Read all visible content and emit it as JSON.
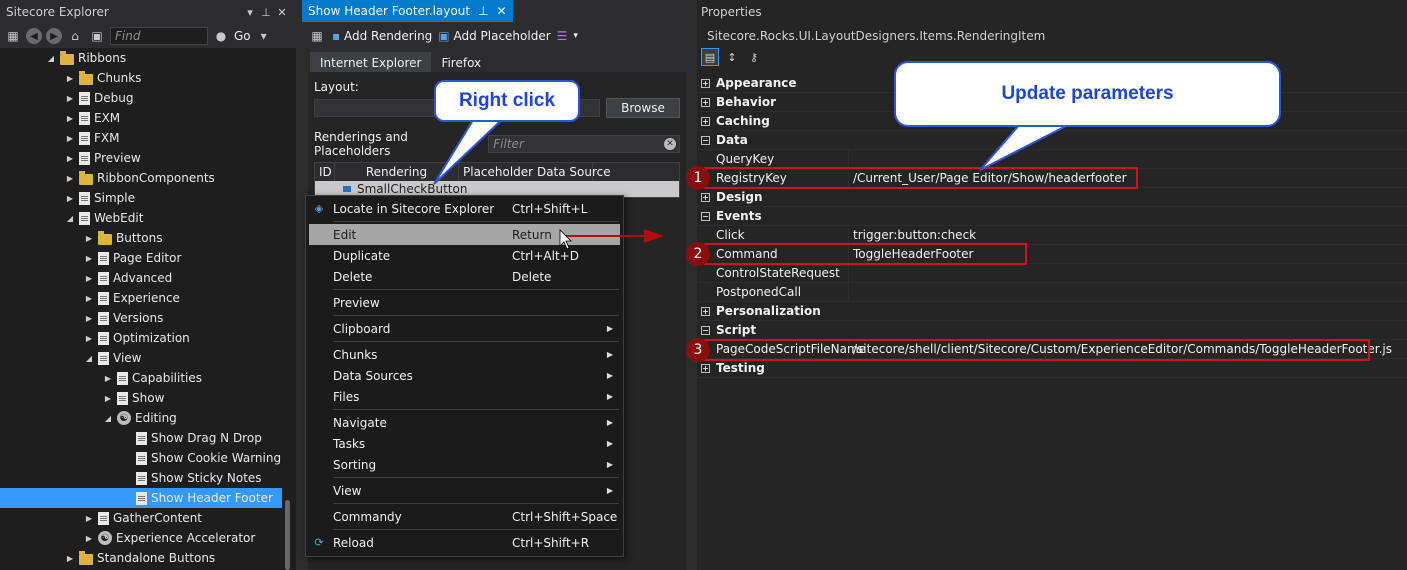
{
  "explorer": {
    "title": "Sitecore Explorer",
    "find_placeholder": "Find",
    "go_label": "Go",
    "tree": [
      {
        "label": "Ribbons",
        "icon": "folder",
        "indent": 1,
        "arrow": "down"
      },
      {
        "label": "Chunks",
        "icon": "folder",
        "indent": 2,
        "arrow": "right"
      },
      {
        "label": "Debug",
        "icon": "doc",
        "indent": 2,
        "arrow": "right"
      },
      {
        "label": "EXM",
        "icon": "doc",
        "indent": 2,
        "arrow": "right"
      },
      {
        "label": "FXM",
        "icon": "doc",
        "indent": 2,
        "arrow": "right"
      },
      {
        "label": "Preview",
        "icon": "doc",
        "indent": 2,
        "arrow": "right"
      },
      {
        "label": "RibbonComponents",
        "icon": "folder",
        "indent": 2,
        "arrow": "right"
      },
      {
        "label": "Simple",
        "icon": "doc",
        "indent": 2,
        "arrow": "right"
      },
      {
        "label": "WebEdit",
        "icon": "doc",
        "indent": 2,
        "arrow": "down"
      },
      {
        "label": "Buttons",
        "icon": "folder",
        "indent": 3,
        "arrow": "right"
      },
      {
        "label": "Page Editor",
        "icon": "doc",
        "indent": 3,
        "arrow": "right"
      },
      {
        "label": "Advanced",
        "icon": "doc",
        "indent": 3,
        "arrow": "right"
      },
      {
        "label": "Experience",
        "icon": "doc",
        "indent": 3,
        "arrow": "right"
      },
      {
        "label": "Versions",
        "icon": "doc",
        "indent": 3,
        "arrow": "right"
      },
      {
        "label": "Optimization",
        "icon": "doc",
        "indent": 3,
        "arrow": "right"
      },
      {
        "label": "View",
        "icon": "doc",
        "indent": 3,
        "arrow": "down"
      },
      {
        "label": "Capabilities",
        "icon": "doc",
        "indent": 4,
        "arrow": "right"
      },
      {
        "label": "Show",
        "icon": "doc",
        "indent": 4,
        "arrow": "right"
      },
      {
        "label": "Editing",
        "icon": "gear",
        "indent": 4,
        "arrow": "down"
      },
      {
        "label": "Show Drag N Drop",
        "icon": "doc",
        "indent": 5,
        "arrow": ""
      },
      {
        "label": "Show Cookie Warning",
        "icon": "doc",
        "indent": 5,
        "arrow": ""
      },
      {
        "label": "Show Sticky Notes",
        "icon": "doc",
        "indent": 5,
        "arrow": ""
      },
      {
        "label": "Show Header Footer",
        "icon": "doc",
        "indent": 5,
        "arrow": "",
        "selected": true
      },
      {
        "label": "GatherContent",
        "icon": "doc",
        "indent": 3,
        "arrow": "right"
      },
      {
        "label": "Experience Accelerator",
        "icon": "gear",
        "indent": 3,
        "arrow": "right"
      },
      {
        "label": "Standalone Buttons",
        "icon": "folder",
        "indent": 2,
        "arrow": "right"
      }
    ]
  },
  "document": {
    "tab_label": "Show Header Footer.layout",
    "add_rendering": "Add Rendering",
    "add_placeholder": "Add Placeholder",
    "browser_tabs": [
      "Internet Explorer",
      "Firefox"
    ],
    "layout_label": "Layout:",
    "browse_label": "Browse",
    "renderings_label": "Renderings and Placeholders",
    "filter_placeholder": "Filter",
    "columns": [
      "ID",
      "Rendering",
      "Placeholder",
      "Data Source"
    ],
    "row_rendering": "SmallCheckButton"
  },
  "context_menu": [
    {
      "label": "Locate in Sitecore Explorer",
      "shortcut": "Ctrl+Shift+L",
      "icon": "locate-icon"
    },
    {
      "sep": true
    },
    {
      "label": "Edit",
      "shortcut": "Return",
      "highlight": true
    },
    {
      "label": "Duplicate",
      "shortcut": "Ctrl+Alt+D"
    },
    {
      "label": "Delete",
      "shortcut": "Delete"
    },
    {
      "sep": true
    },
    {
      "label": "Preview"
    },
    {
      "sep": true
    },
    {
      "label": "Clipboard",
      "submenu": true
    },
    {
      "sep": true
    },
    {
      "label": "Chunks",
      "submenu": true
    },
    {
      "label": "Data Sources",
      "submenu": true
    },
    {
      "label": "Files",
      "submenu": true
    },
    {
      "sep": true
    },
    {
      "label": "Navigate",
      "submenu": true
    },
    {
      "label": "Tasks",
      "submenu": true
    },
    {
      "label": "Sorting",
      "submenu": true
    },
    {
      "sep": true
    },
    {
      "label": "View",
      "submenu": true
    },
    {
      "sep": true
    },
    {
      "label": "Commandy",
      "shortcut": "Ctrl+Shift+Space"
    },
    {
      "sep": true
    },
    {
      "label": "Reload",
      "shortcut": "Ctrl+Shift+R",
      "icon": "reload-icon"
    }
  ],
  "properties": {
    "title": "Properties",
    "object": "Sitecore.Rocks.UI.LayoutDesigners.Items.RenderingItem",
    "rows": [
      {
        "cat": true,
        "name": "Appearance",
        "expanded": false
      },
      {
        "cat": true,
        "name": "Behavior",
        "expanded": false
      },
      {
        "cat": true,
        "name": "Caching",
        "expanded": false
      },
      {
        "cat": true,
        "name": "Data",
        "expanded": true
      },
      {
        "name": "QueryKey",
        "value": ""
      },
      {
        "name": "RegistryKey",
        "value": "/Current_User/Page Editor/Show/headerfooter"
      },
      {
        "cat": true,
        "name": "Design",
        "expanded": false
      },
      {
        "cat": true,
        "name": "Events",
        "expanded": true
      },
      {
        "name": "Click",
        "value": "trigger:button:check"
      },
      {
        "name": "Command",
        "value": "ToggleHeaderFooter"
      },
      {
        "name": "ControlStateRequest",
        "value": ""
      },
      {
        "name": "PostponedCall",
        "value": ""
      },
      {
        "cat": true,
        "name": "Personalization",
        "expanded": false
      },
      {
        "cat": true,
        "name": "Script",
        "expanded": true
      },
      {
        "name": "PageCodeScriptFileName",
        "value": "/sitecore/shell/client/Sitecore/Custom/ExperienceEditor/Commands/ToggleHeaderFooter.js"
      },
      {
        "cat": true,
        "name": "Testing",
        "expanded": false
      }
    ]
  },
  "annotations": {
    "right_click": "Right click",
    "update_parameters": "Update parameters",
    "badges": [
      "1",
      "2",
      "3"
    ],
    "accent_color": "#d0141f",
    "callout_color": "#1f45d8"
  }
}
